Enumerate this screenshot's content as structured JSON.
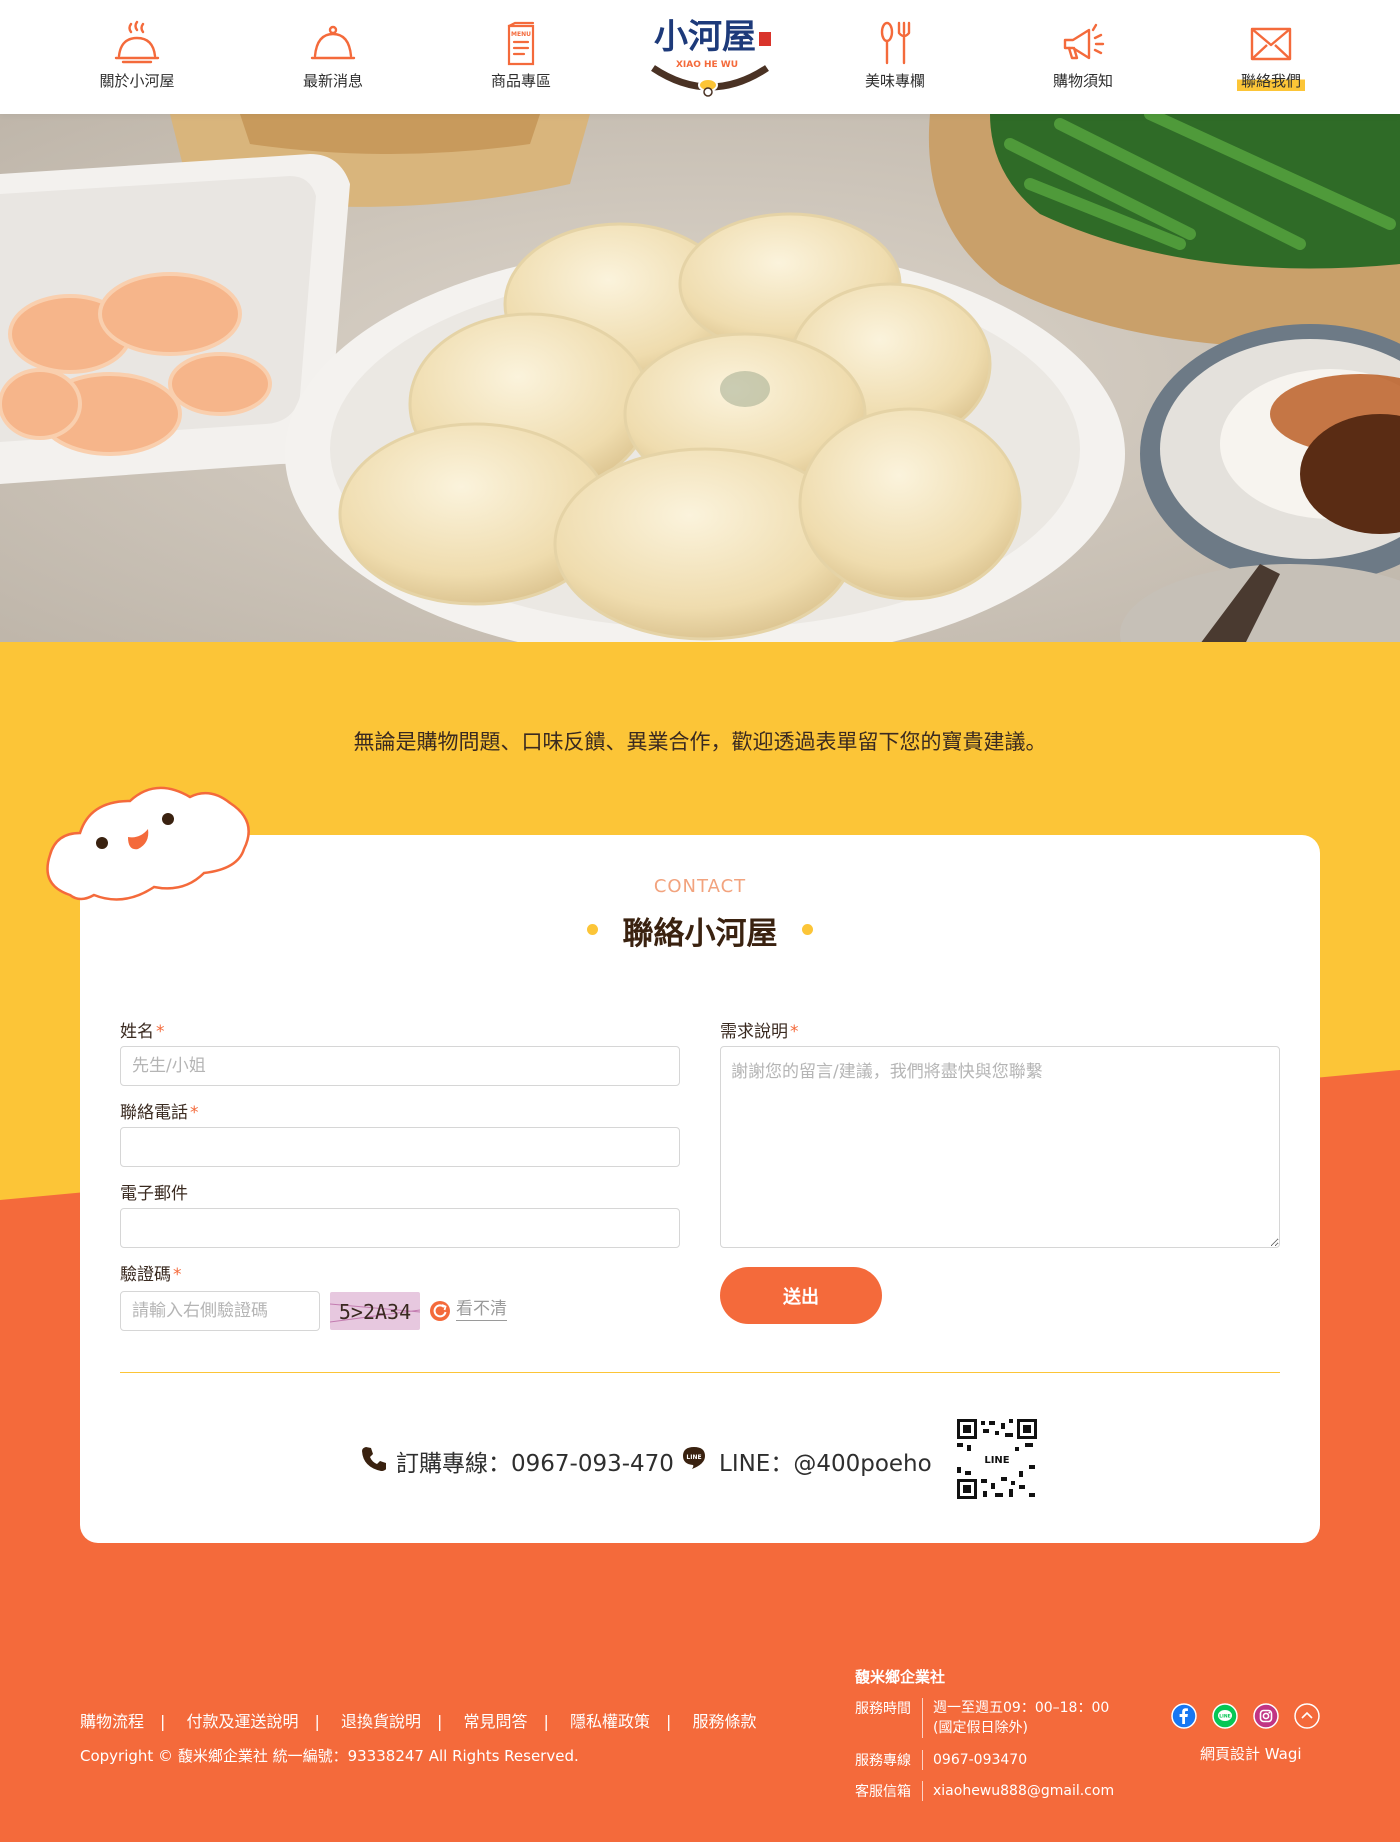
{
  "nav": {
    "items": [
      {
        "label": "關於小河屋",
        "icon": "cloche-steam-icon"
      },
      {
        "label": "最新消息",
        "icon": "cloche-icon"
      },
      {
        "label": "商品專區",
        "icon": "menu-book-icon"
      },
      {
        "label": "美味專欄",
        "icon": "fork-spoon-icon"
      },
      {
        "label": "購物須知",
        "icon": "megaphone-icon"
      },
      {
        "label": "聯絡我們",
        "icon": "envelope-icon",
        "active": true
      }
    ],
    "logo": {
      "title": "小河屋",
      "subtitle": "XIAO HE WU"
    }
  },
  "hero": {
    "image": "dumplings-photo"
  },
  "contact": {
    "intro": "無論是購物問題、口味反饋、異業合作，歡迎透過表單留下您的寶貴建議。",
    "eyebrow": "CONTACT",
    "title": "聯絡小河屋",
    "form": {
      "name": {
        "label": "姓名",
        "placeholder": "先生/小姐",
        "required": true
      },
      "phone": {
        "label": "聯絡電話",
        "placeholder": "",
        "required": true
      },
      "email": {
        "label": "電子郵件",
        "placeholder": "",
        "required": false
      },
      "captcha": {
        "label": "驗證碼",
        "placeholder": "請輸入右側驗證碼",
        "code": "5>2A34",
        "refresh_label": "看不清",
        "required": true
      },
      "message": {
        "label": "需求說明",
        "placeholder": "謝謝您的留言/建議，我們將盡快與您聯繫",
        "required": true
      },
      "submit": "送出",
      "required_mark": "*"
    },
    "order_line": "訂購專線：0967-093-470",
    "line_id": "LINE：@400poeho",
    "qr_label": "LINE"
  },
  "footer": {
    "links": [
      "購物流程",
      "付款及運送說明",
      "退換貨說明",
      "常見問答",
      "隱私權政策",
      "服務條款"
    ],
    "separator": "|",
    "copyright": "Copyright © 馥米鄉企業社 統一編號：93338247 All Rights Reserved.",
    "company": "馥米鄉企業社",
    "hours_label": "服務時間",
    "hours": "週一至週五09：00–18：00",
    "hours_note": "(國定假日除外)",
    "hotline_label": "服務專線",
    "hotline": "0967-093470",
    "email_label": "客服信箱",
    "email": "xiaohewu888@gmail.com",
    "designer": "網頁設計 Wagi",
    "colors": {
      "orange": "#f46a3b",
      "yellow": "#fcc537",
      "facebook": "#1877f2",
      "line": "#06c755",
      "instagram": "#c13584"
    }
  }
}
